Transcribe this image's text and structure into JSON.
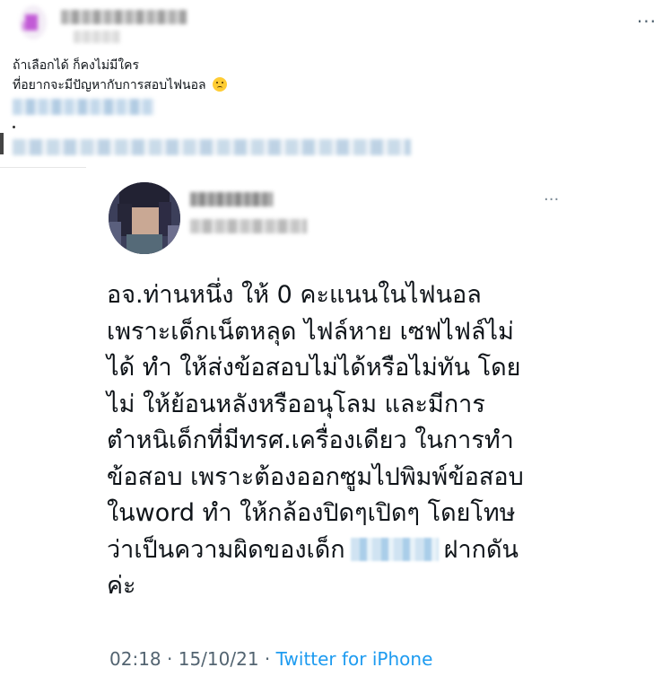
{
  "outer_post": {
    "more_icon": "···",
    "text_line_1": "ถ้าเลือกได้ ก็คงไม่มีใคร",
    "text_line_2": "ที่อยากจะมีปัญหากับการสอบไฟนอล",
    "emoji_icon": "sad-face-emoji",
    "avatar_color": "#c25ad6"
  },
  "embedded_tweet": {
    "more_icon": "···",
    "text_lines": [
      "อจ.ท่านหนึ่ง ให้ 0 คะแนนในไฟนอล",
      "เพราะเด็กเน็ตหลุด ไฟล์หาย เซฟไฟล์ไม่",
      "ได้ ทำ ให้ส่งข้อสอบไม่ได้หรือไม่ทัน โดย",
      "ไม่ ให้ย้อนหลังหรืออนุโลม และมีการ",
      "ตำหนิเด็กที่มีทรศ.เครื่องเดียว ในการทำ",
      "ข้อสอบ เพราะต้องออกซูมไปพิมพ์ข้อสอบ",
      "ในword ทำ ให้กล้องปิดๆเปิดๆ โดยโทษ"
    ],
    "line_8_start": "ว่าเป็นความผิดของเด็ก",
    "line_8_end": "ฝากดัน",
    "line_9": "ค่ะ",
    "time": "02:18",
    "separator": "·",
    "date": "15/10/21",
    "source": "Twitter for iPhone",
    "source_color": "#1d9bf0"
  }
}
